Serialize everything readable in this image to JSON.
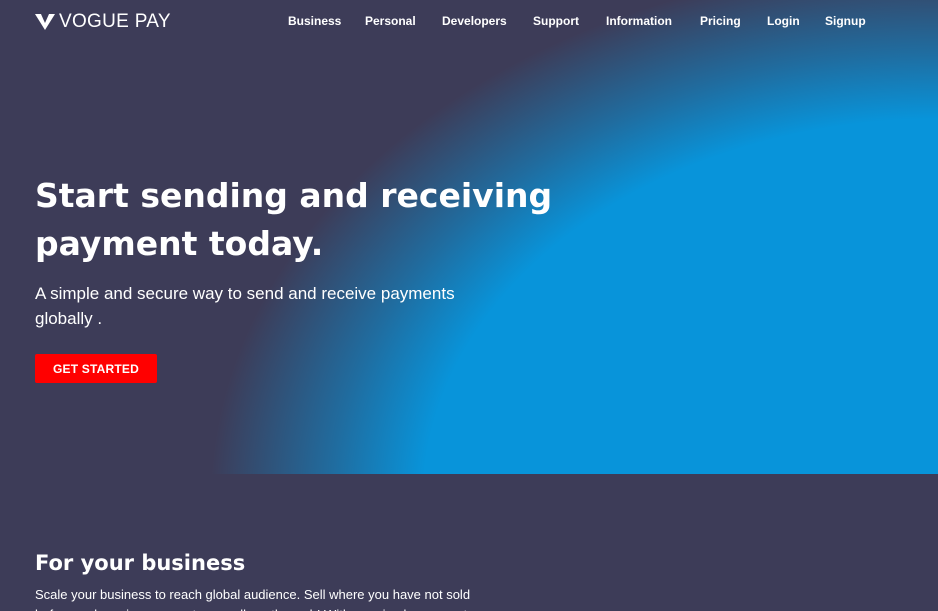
{
  "brand": {
    "name": "VOGUE PAY",
    "logo_icon": "voguepay-v-logo"
  },
  "nav": {
    "items": [
      {
        "label": "Business"
      },
      {
        "label": "Personal"
      },
      {
        "label": "Developers"
      },
      {
        "label": "Support"
      },
      {
        "label": "Information"
      },
      {
        "label": "Pricing"
      },
      {
        "label": "Login"
      },
      {
        "label": "Signup"
      }
    ]
  },
  "hero": {
    "title": "Start sending and receiving payment today.",
    "subtitle": "A simple and secure way to send and receive payments globally .",
    "cta_label": "GET STARTED"
  },
  "business": {
    "title": "For your business",
    "text": "Scale your business to reach global audience. Sell where you have not sold before and receive payments as well, on the web! With our simple payment"
  },
  "colors": {
    "background": "#3d3c58",
    "hero_blue": "#0894da",
    "cta": "#ff0000",
    "text": "#ffffff"
  }
}
